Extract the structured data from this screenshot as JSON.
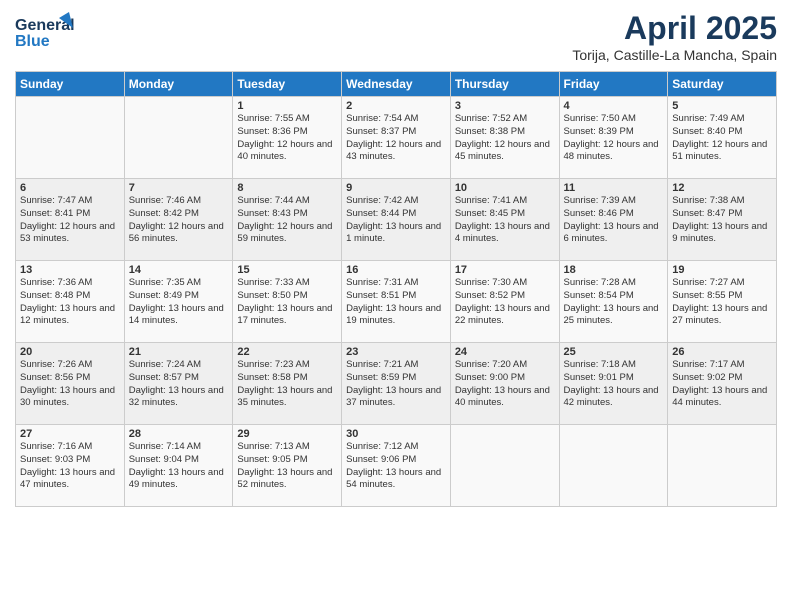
{
  "header": {
    "logo_line1": "General",
    "logo_line2": "Blue",
    "title": "April 2025",
    "subtitle": "Torija, Castille-La Mancha, Spain"
  },
  "days_of_week": [
    "Sunday",
    "Monday",
    "Tuesday",
    "Wednesday",
    "Thursday",
    "Friday",
    "Saturday"
  ],
  "weeks": [
    [
      {
        "day": "",
        "info": ""
      },
      {
        "day": "",
        "info": ""
      },
      {
        "day": "1",
        "info": "Sunrise: 7:55 AM\nSunset: 8:36 PM\nDaylight: 12 hours and 40 minutes."
      },
      {
        "day": "2",
        "info": "Sunrise: 7:54 AM\nSunset: 8:37 PM\nDaylight: 12 hours and 43 minutes."
      },
      {
        "day": "3",
        "info": "Sunrise: 7:52 AM\nSunset: 8:38 PM\nDaylight: 12 hours and 45 minutes."
      },
      {
        "day": "4",
        "info": "Sunrise: 7:50 AM\nSunset: 8:39 PM\nDaylight: 12 hours and 48 minutes."
      },
      {
        "day": "5",
        "info": "Sunrise: 7:49 AM\nSunset: 8:40 PM\nDaylight: 12 hours and 51 minutes."
      }
    ],
    [
      {
        "day": "6",
        "info": "Sunrise: 7:47 AM\nSunset: 8:41 PM\nDaylight: 12 hours and 53 minutes."
      },
      {
        "day": "7",
        "info": "Sunrise: 7:46 AM\nSunset: 8:42 PM\nDaylight: 12 hours and 56 minutes."
      },
      {
        "day": "8",
        "info": "Sunrise: 7:44 AM\nSunset: 8:43 PM\nDaylight: 12 hours and 59 minutes."
      },
      {
        "day": "9",
        "info": "Sunrise: 7:42 AM\nSunset: 8:44 PM\nDaylight: 13 hours and 1 minute."
      },
      {
        "day": "10",
        "info": "Sunrise: 7:41 AM\nSunset: 8:45 PM\nDaylight: 13 hours and 4 minutes."
      },
      {
        "day": "11",
        "info": "Sunrise: 7:39 AM\nSunset: 8:46 PM\nDaylight: 13 hours and 6 minutes."
      },
      {
        "day": "12",
        "info": "Sunrise: 7:38 AM\nSunset: 8:47 PM\nDaylight: 13 hours and 9 minutes."
      }
    ],
    [
      {
        "day": "13",
        "info": "Sunrise: 7:36 AM\nSunset: 8:48 PM\nDaylight: 13 hours and 12 minutes."
      },
      {
        "day": "14",
        "info": "Sunrise: 7:35 AM\nSunset: 8:49 PM\nDaylight: 13 hours and 14 minutes."
      },
      {
        "day": "15",
        "info": "Sunrise: 7:33 AM\nSunset: 8:50 PM\nDaylight: 13 hours and 17 minutes."
      },
      {
        "day": "16",
        "info": "Sunrise: 7:31 AM\nSunset: 8:51 PM\nDaylight: 13 hours and 19 minutes."
      },
      {
        "day": "17",
        "info": "Sunrise: 7:30 AM\nSunset: 8:52 PM\nDaylight: 13 hours and 22 minutes."
      },
      {
        "day": "18",
        "info": "Sunrise: 7:28 AM\nSunset: 8:54 PM\nDaylight: 13 hours and 25 minutes."
      },
      {
        "day": "19",
        "info": "Sunrise: 7:27 AM\nSunset: 8:55 PM\nDaylight: 13 hours and 27 minutes."
      }
    ],
    [
      {
        "day": "20",
        "info": "Sunrise: 7:26 AM\nSunset: 8:56 PM\nDaylight: 13 hours and 30 minutes."
      },
      {
        "day": "21",
        "info": "Sunrise: 7:24 AM\nSunset: 8:57 PM\nDaylight: 13 hours and 32 minutes."
      },
      {
        "day": "22",
        "info": "Sunrise: 7:23 AM\nSunset: 8:58 PM\nDaylight: 13 hours and 35 minutes."
      },
      {
        "day": "23",
        "info": "Sunrise: 7:21 AM\nSunset: 8:59 PM\nDaylight: 13 hours and 37 minutes."
      },
      {
        "day": "24",
        "info": "Sunrise: 7:20 AM\nSunset: 9:00 PM\nDaylight: 13 hours and 40 minutes."
      },
      {
        "day": "25",
        "info": "Sunrise: 7:18 AM\nSunset: 9:01 PM\nDaylight: 13 hours and 42 minutes."
      },
      {
        "day": "26",
        "info": "Sunrise: 7:17 AM\nSunset: 9:02 PM\nDaylight: 13 hours and 44 minutes."
      }
    ],
    [
      {
        "day": "27",
        "info": "Sunrise: 7:16 AM\nSunset: 9:03 PM\nDaylight: 13 hours and 47 minutes."
      },
      {
        "day": "28",
        "info": "Sunrise: 7:14 AM\nSunset: 9:04 PM\nDaylight: 13 hours and 49 minutes."
      },
      {
        "day": "29",
        "info": "Sunrise: 7:13 AM\nSunset: 9:05 PM\nDaylight: 13 hours and 52 minutes."
      },
      {
        "day": "30",
        "info": "Sunrise: 7:12 AM\nSunset: 9:06 PM\nDaylight: 13 hours and 54 minutes."
      },
      {
        "day": "",
        "info": ""
      },
      {
        "day": "",
        "info": ""
      },
      {
        "day": "",
        "info": ""
      }
    ]
  ]
}
